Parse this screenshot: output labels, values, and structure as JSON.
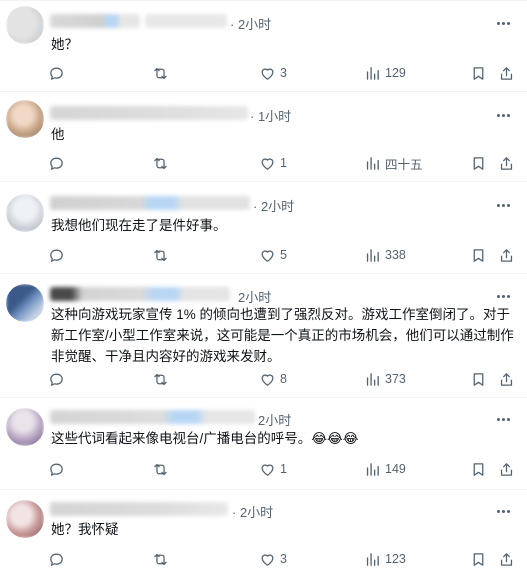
{
  "colors": {
    "text_primary": "#0f1419",
    "text_secondary": "#536471",
    "divider": "#eff3f4",
    "blur_blue": "#b8d6f4"
  },
  "icons": {
    "reply": "speech-bubble-icon",
    "repost": "repost-arrows-icon",
    "like": "heart-icon",
    "views": "bar-chart-icon",
    "bookmark": "bookmark-icon",
    "share": "share-upload-icon",
    "more": "more-dots-icon"
  },
  "posts": [
    {
      "handle_fragment": "...",
      "time": "· 2小时",
      "text": "她？",
      "replies": "",
      "reposts": "",
      "likes": "3",
      "views": "129"
    },
    {
      "handle_fragment": "",
      "time": "· 1小时",
      "text": "他",
      "replies": "",
      "reposts": "",
      "likes": "1",
      "views": "四十五"
    },
    {
      "handle_fragment": "",
      "time": "· 2小时",
      "text": "我想他们现在走了是件好事。",
      "replies": "",
      "reposts": "",
      "likes": "5",
      "views": "338"
    },
    {
      "handle_fragment": "",
      "time": "2小时",
      "text": "这种向游戏玩家宣传 1% 的倾向也遭到了强烈反对。游戏工作室倒闭了。对于\n新工作室/小型工作室来说，这可能是一个真正的市场机会，他们可以通过制作\n非觉醒、干净且内容好的游戏来发财。",
      "replies": "",
      "reposts": "",
      "likes": "8",
      "views": "373"
    },
    {
      "handle_fragment": "",
      "time": "2小时",
      "text": "这些代词看起来像电视台/广播电台的呼号。😂😂😂",
      "replies": "",
      "reposts": "",
      "likes": "1",
      "views": "149"
    },
    {
      "handle_fragment": "",
      "time": "· 2小时",
      "text": "她？我怀疑",
      "replies": "",
      "reposts": "",
      "likes": "3",
      "views": "123"
    }
  ]
}
